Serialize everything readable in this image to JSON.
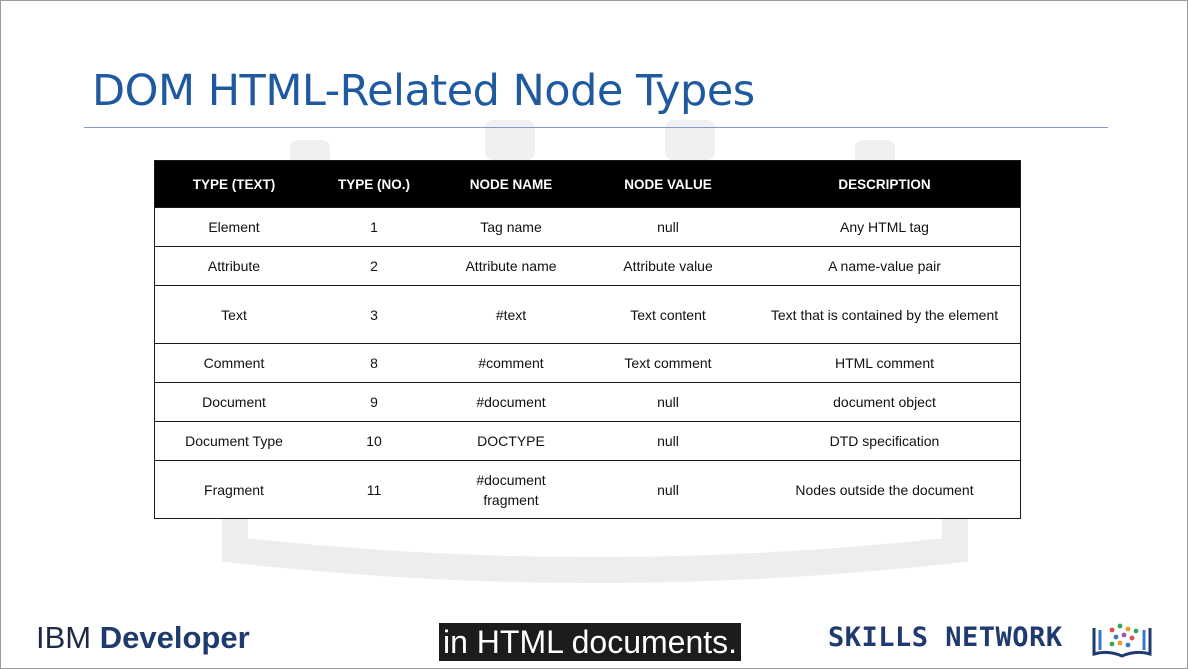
{
  "slide": {
    "title": "DOM HTML-Related Node Types"
  },
  "table": {
    "headers": [
      "TYPE (TEXT)",
      "TYPE (NO.)",
      "NODE NAME",
      "NODE VALUE",
      "DESCRIPTION"
    ],
    "rows": [
      [
        "Element",
        "1",
        "Tag name",
        "null",
        "Any HTML tag"
      ],
      [
        "Attribute",
        "2",
        "Attribute name",
        "Attribute value",
        "A name-value pair"
      ],
      [
        "Text",
        "3",
        "#text",
        "Text content",
        "Text that is contained by the element"
      ],
      [
        "Comment",
        "8",
        "#comment",
        "Text comment",
        "HTML comment"
      ],
      [
        "Document",
        "9",
        "#document",
        "null",
        "document object"
      ],
      [
        "Document Type",
        "10",
        "DOCTYPE",
        "null",
        "DTD specification"
      ],
      [
        "Fragment",
        "11",
        "#document fragment",
        "null",
        "Nodes outside the document"
      ]
    ]
  },
  "footer": {
    "ibm_prefix": "IBM ",
    "ibm_bold": "Developer",
    "caption": "in HTML documents.",
    "skills": "SKILLS NETWORK"
  },
  "colors": {
    "title": "#1f5aa0",
    "header_bg": "#000000",
    "brand": "#1e3a6e"
  },
  "icons": {
    "skills_logo": "book-with-dots-icon",
    "watermark": "book-watermark-icon"
  }
}
